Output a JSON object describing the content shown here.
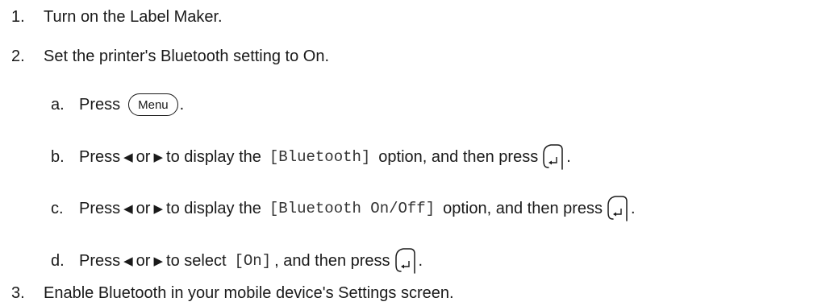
{
  "steps": [
    {
      "num": "1.",
      "text": "Turn on the Label Maker."
    },
    {
      "num": "2.",
      "text": "Set the printer's Bluetooth setting to On."
    },
    {
      "num": "3.",
      "text": "Enable Bluetooth in your mobile device's Settings screen."
    }
  ],
  "substeps": {
    "a": {
      "letter": "a.",
      "press": "Press",
      "menu_key": "Menu",
      "end": "."
    },
    "b": {
      "letter": "b.",
      "press": "Press",
      "or": "or",
      "to_display": "to display the",
      "option_code": "[Bluetooth]",
      "rest": "option, and then press",
      "end": "."
    },
    "c": {
      "letter": "c.",
      "press": "Press",
      "or": "or",
      "to_display": "to display the",
      "option_code": "[Bluetooth On/Off]",
      "rest": "option, and then press",
      "end": "."
    },
    "d": {
      "letter": "d.",
      "press": "Press",
      "or": "or",
      "to_select": "to select",
      "option_code": "[On]",
      "rest": ", and then press",
      "end": "."
    }
  },
  "icons": {
    "left_arrow": "◀",
    "right_arrow": "▶",
    "enter_key": "enter-key-icon"
  }
}
